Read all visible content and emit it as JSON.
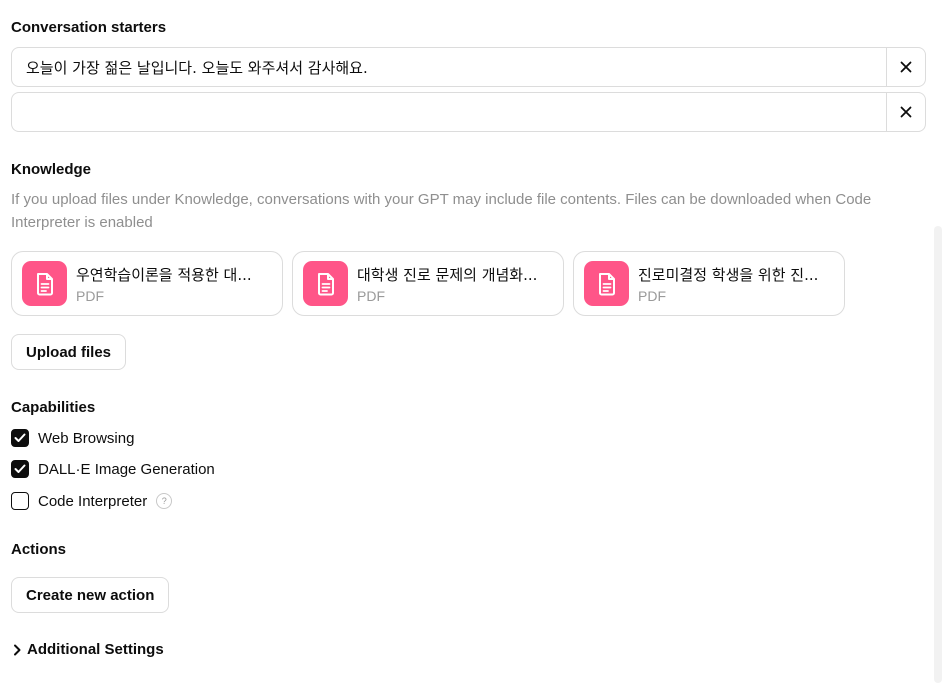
{
  "conversation_starters": {
    "title": "Conversation starters",
    "items": [
      {
        "value": "오늘이 가장 젊은 날입니다. 오늘도 와주셔서 감사해요.",
        "placeholder": ""
      },
      {
        "value": "",
        "placeholder": ""
      }
    ]
  },
  "knowledge": {
    "title": "Knowledge",
    "description": "If you upload files under Knowledge, conversations with your GPT may include file contents. Files can be downloaded when Code Interpreter is enabled",
    "files": [
      {
        "name": "우연학습이론을 적용한 대...",
        "type": "PDF"
      },
      {
        "name": "대학생 진로 문제의 개념화...",
        "type": "PDF"
      },
      {
        "name": "진로미결정 학생을 위한 진...",
        "type": "PDF"
      }
    ],
    "upload_label": "Upload files",
    "file_icon": "document-icon",
    "file_icon_color": "#ff5588"
  },
  "capabilities": {
    "title": "Capabilities",
    "items": [
      {
        "label": "Web Browsing",
        "checked": true
      },
      {
        "label": "DALL·E Image Generation",
        "checked": true
      },
      {
        "label": "Code Interpreter",
        "checked": false,
        "help": "?"
      }
    ]
  },
  "actions": {
    "title": "Actions",
    "create_label": "Create new action"
  },
  "additional_settings": {
    "label": "Additional Settings",
    "icon": "chevron-right-icon"
  }
}
